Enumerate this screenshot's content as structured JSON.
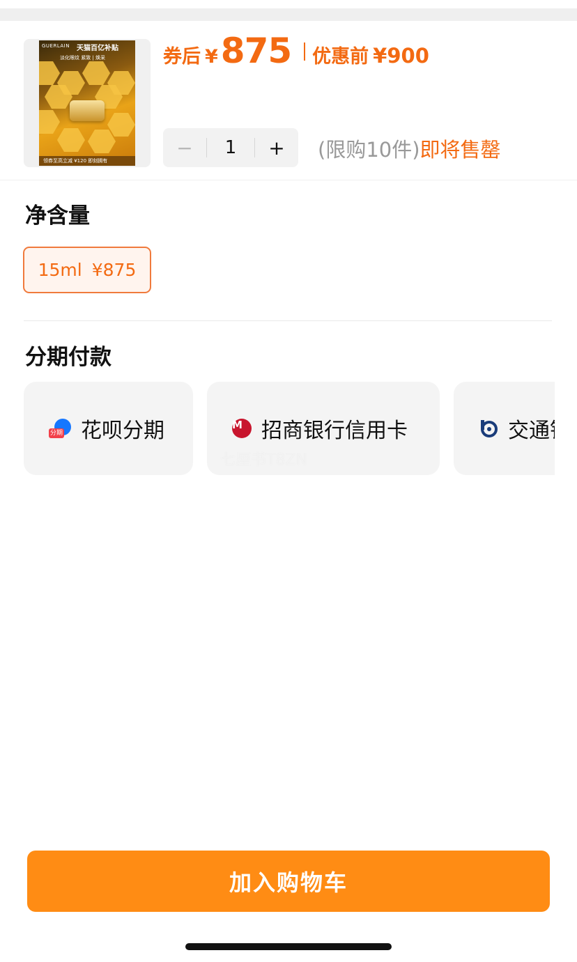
{
  "product": {
    "image": {
      "brand": "GUERLAIN",
      "title": "天猫百亿补贴",
      "subtitle": "淡化眼纹 紧致 | 焕采",
      "band_text": "领券至高立减 ¥120 即刻拥有"
    },
    "coupon_label": "券后",
    "currency": "¥",
    "price": "875",
    "pre_discount_label": "优惠前",
    "pre_discount_price": "¥900"
  },
  "quantity": {
    "minus": "−",
    "value": "1",
    "plus": "+",
    "limit_text": "(限购10件)",
    "status_text": "即将售罄"
  },
  "volume": {
    "title": "净含量",
    "option_size": "15ml",
    "option_price": "¥875",
    "selected": true
  },
  "installment": {
    "title": "分期付款",
    "options": [
      {
        "label": "花呗分期",
        "icon": "huabei-icon",
        "icon_tag": "分期"
      },
      {
        "label": "招商银行信用卡",
        "icon": "cmb-bank-icon"
      },
      {
        "label": "交通银行信用卡",
        "icon": "bocom-bank-icon"
      }
    ]
  },
  "watermark": "七厘书T8ZN",
  "cart_button": "加入购物车",
  "colors": {
    "accent": "#f36a12",
    "cart_button": "#ff8c14",
    "option_border": "#f07a3c",
    "option_bg": "#fff4ee",
    "card_bg": "#f4f4f4"
  }
}
